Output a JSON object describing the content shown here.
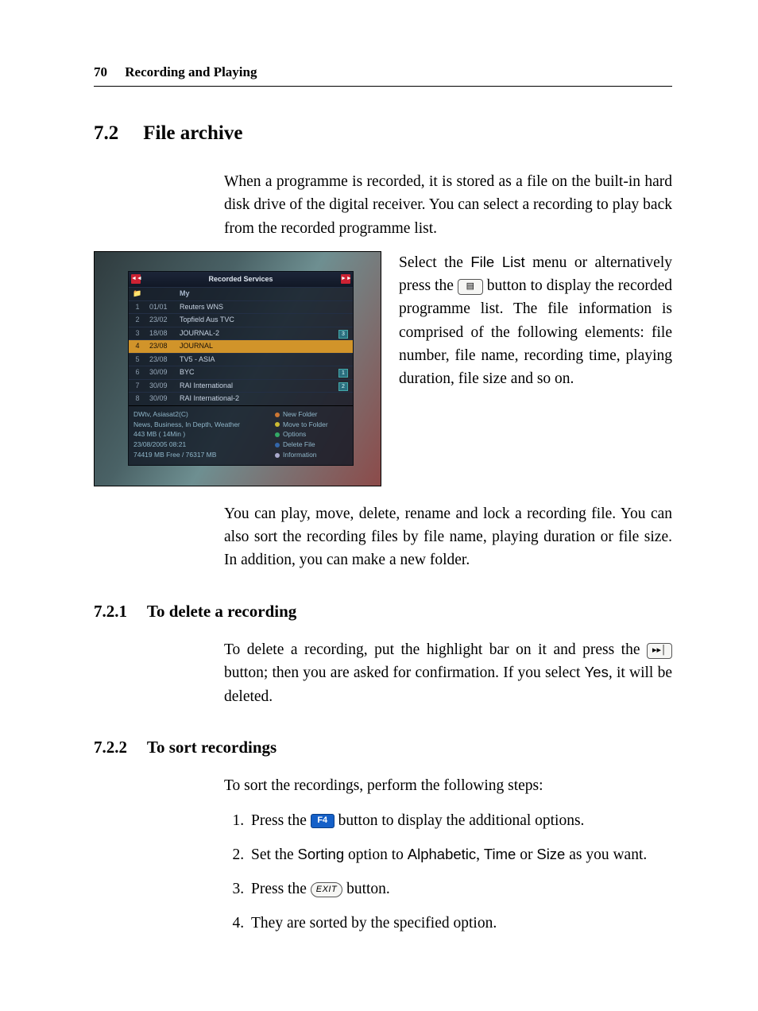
{
  "page": {
    "number": "70",
    "running_title": "Recording and Playing"
  },
  "sec72": {
    "num": "7.2",
    "title": "File archive",
    "intro": "When a programme is recorded, it is stored as a file on the built-in hard disk drive of the digital receiver. You can select a recording to play back from the recorded programme list.",
    "side_para_a": "Select the ",
    "side_para_b": " menu or alternatively press the ",
    "side_para_c": " button to display the recorded programme list. The file information is comprised of the following elements: file number, file name, recording time, playing duration, file size and so on.",
    "para2": "You can play, move, delete, rename and lock a recording file. You can also sort the recording files by file name, playing duration or file size. In addition, you can make a new folder.",
    "menu_label": "File List"
  },
  "sec721": {
    "num": "7.2.1",
    "title": "To delete a recording",
    "p_a": "To delete a recording, put the highlight bar on it and press the ",
    "p_b": " button; then you are asked for confirmation. If you select ",
    "p_c": ", it will be deleted.",
    "yes_label": "Yes"
  },
  "sec722": {
    "num": "7.2.2",
    "title": "To sort recordings",
    "intro": "To sort the recordings, perform the following steps:",
    "steps": {
      "s1a": "Press the ",
      "s1b": " button to display the additional options.",
      "s2a": "Set the ",
      "s2b": " option to ",
      "s2c": " or ",
      "s2d": " as you want.",
      "opt_sorting": "Sorting",
      "opt_alpha": "Alphabetic",
      "opt_time": "Time",
      "opt_size": "Size",
      "s3a": "Press the ",
      "s3b": " button.",
      "s4": "They are sorted by the specified option."
    },
    "keys": {
      "f4": "F4",
      "exit": "EXIT"
    }
  },
  "screenshot": {
    "title": "Recorded Services",
    "corner_left": "◄◄",
    "corner_right": "►►",
    "folder_icon": "📁",
    "folder_name": "My",
    "rows": [
      {
        "idx": "1",
        "date": "01/01",
        "name": "Reuters WNS",
        "ind": ""
      },
      {
        "idx": "2",
        "date": "23/02",
        "name": "Topfield Aus TVC",
        "ind": ""
      },
      {
        "idx": "3",
        "date": "18/08",
        "name": "JOURNAL-2",
        "ind": "3"
      },
      {
        "idx": "4",
        "date": "23/08",
        "name": "JOURNAL",
        "ind": "",
        "hl": true
      },
      {
        "idx": "5",
        "date": "23/08",
        "name": "TV5 - ASIA",
        "ind": ""
      },
      {
        "idx": "6",
        "date": "30/09",
        "name": "BYC",
        "ind": "1"
      },
      {
        "idx": "7",
        "date": "30/09",
        "name": "RAI International",
        "ind": "2"
      },
      {
        "idx": "8",
        "date": "30/09",
        "name": "RAI International-2",
        "ind": ""
      }
    ],
    "info_left": [
      "DWtv, Asiasat2(C)",
      "News, Business, In Depth, Weather",
      "443 MB ( 14Min )",
      "23/08/2005 08:21",
      "74419 MB Free / 76317 MB"
    ],
    "info_right": [
      "New Folder",
      "Move to Folder",
      "Options",
      "Delete File",
      "Information"
    ]
  }
}
